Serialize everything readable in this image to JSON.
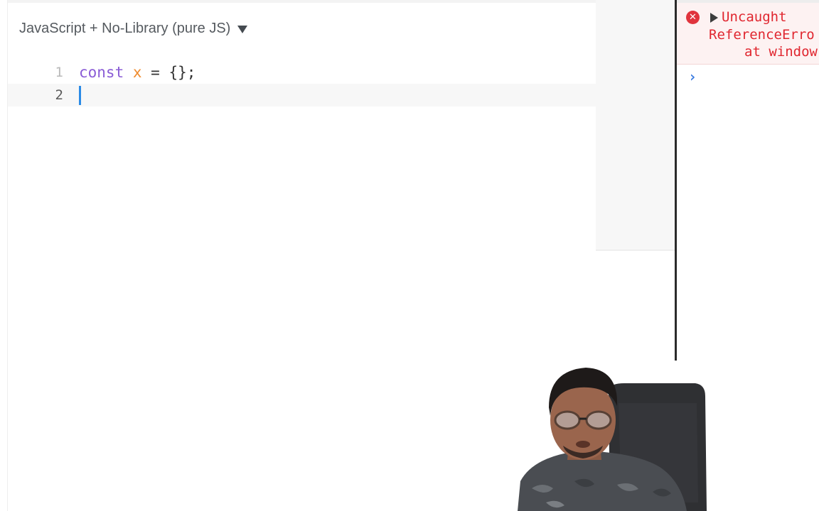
{
  "editor": {
    "language_label": "JavaScript + No-Library (pure JS)",
    "lines": [
      {
        "number": "1",
        "tokens": {
          "keyword": "const",
          "space1": " ",
          "variable": "x",
          "rest": " = {};"
        }
      },
      {
        "number": "2",
        "text": ""
      }
    ]
  },
  "console": {
    "error": {
      "line1": "Uncaught",
      "line2": "ReferenceErro",
      "line3": "at window"
    },
    "prompt": "›"
  },
  "colors": {
    "keyword": "#8a5cd6",
    "variable": "#ef8b2e",
    "cursor": "#2a8be6",
    "error_text": "#e0262f",
    "error_background": "#fdf2f2",
    "prompt": "#3a7be0"
  },
  "icons": {
    "language_dropdown": "caret-down-icon",
    "error": "error-circle-x-icon",
    "expand": "expand-triangle-icon",
    "console_prompt": "chevron-right-icon"
  }
}
